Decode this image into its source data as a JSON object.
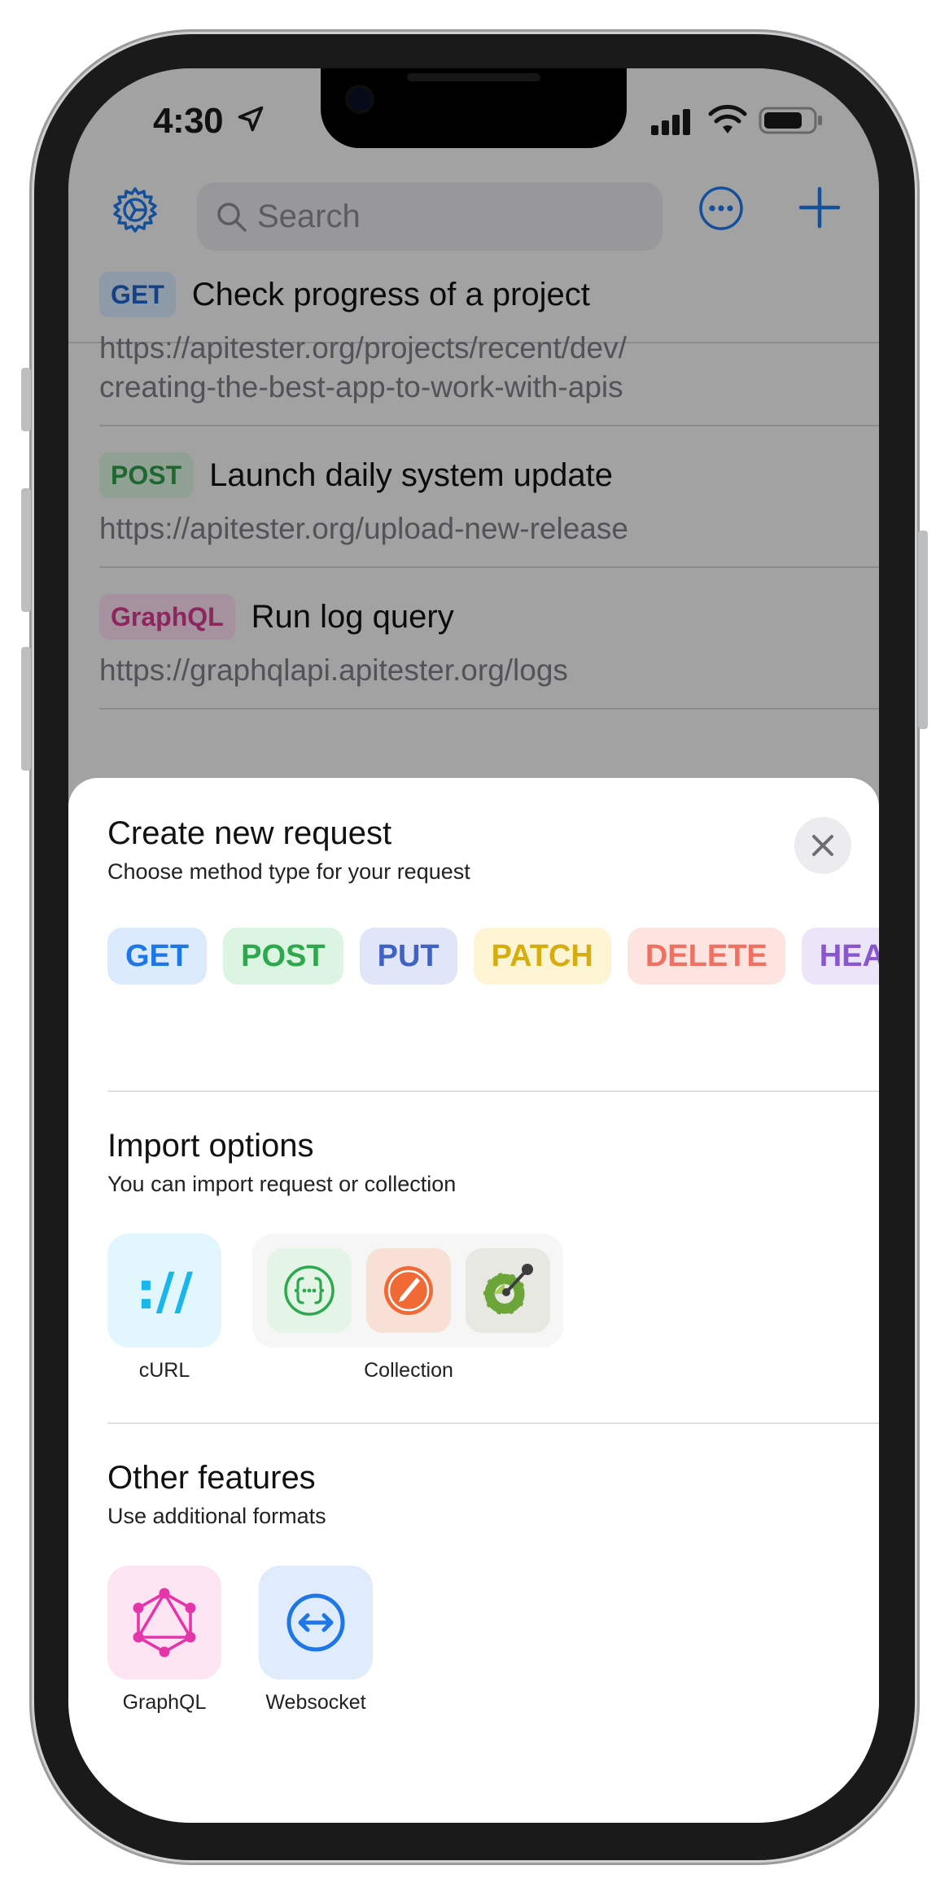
{
  "status_bar": {
    "time": "4:30"
  },
  "toolbar": {
    "search_placeholder": "Search"
  },
  "requests": [
    {
      "method": "GET",
      "title": "Check progress of a project",
      "url_line1": "https://apitester.org/projects/recent/dev/",
      "url_line2": "creating-the-best-app-to-work-with-apis"
    },
    {
      "method": "POST",
      "title": "Launch daily system update",
      "url_line1": "https://apitester.org/upload-new-release",
      "url_line2": ""
    },
    {
      "method": "GraphQL",
      "title": "Run log query",
      "url_line1": "https://graphqlapi.apitester.org/logs",
      "url_line2": ""
    }
  ],
  "sheet": {
    "title": "Create new request",
    "subtitle": "Choose method type for your request",
    "methods": [
      "GET",
      "POST",
      "PUT",
      "PATCH",
      "DELETE",
      "HEAD"
    ],
    "import": {
      "title": "Import options",
      "subtitle": "You can import request or collection",
      "curl_label": "cURL",
      "curl_glyph": "://",
      "collection_label": "Collection"
    },
    "other": {
      "title": "Other features",
      "subtitle": "Use additional formats",
      "graphql_label": "GraphQL",
      "websocket_label": "Websocket"
    }
  },
  "colors": {
    "accent": "#1f77e6",
    "get": "#1f77e6",
    "post": "#2da84e",
    "put": "#3f62c4",
    "patch": "#d6ac10",
    "delete": "#f07062",
    "head": "#8a56d0",
    "graphql": "#e535ab"
  },
  "icons": {
    "toolbar": [
      "gear-icon",
      "search-icon",
      "more-icon",
      "plus-icon"
    ],
    "import": [
      "curl-icon",
      "json-collection-icon",
      "postman-icon",
      "openapi-icon"
    ],
    "other": [
      "graphql-icon",
      "websocket-icon"
    ]
  }
}
